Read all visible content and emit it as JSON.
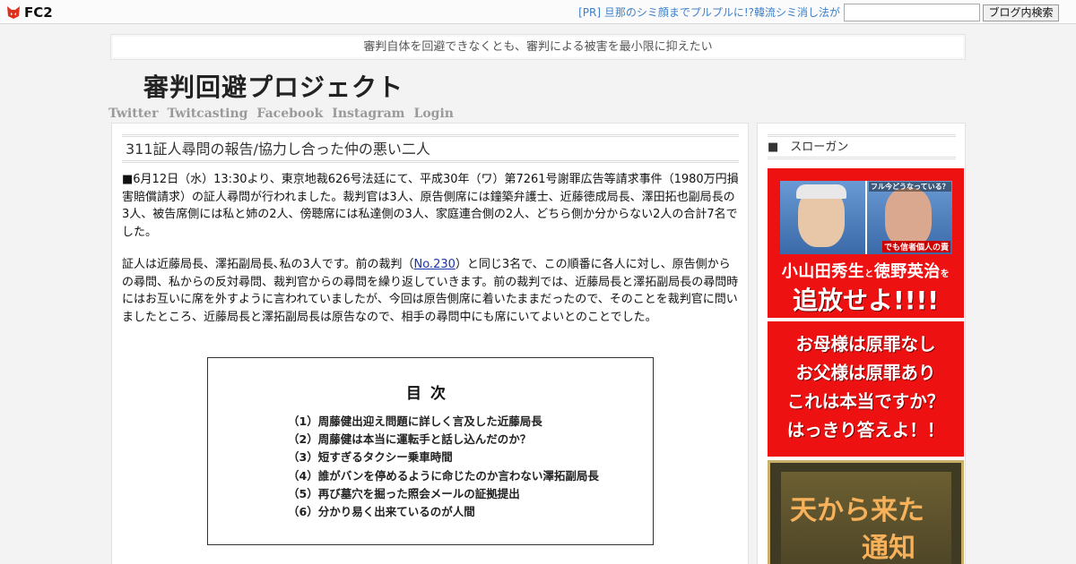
{
  "topbar": {
    "logo": "FC2",
    "pr_link": "[PR] 旦那のシミ顔までプルプルに!?韓流シミ消し法が",
    "search_placeholder": "",
    "search_button": "ブログ内検索"
  },
  "header": {
    "tagline": "審判自体を回避できなくとも、審判による被害を最小限に抑えたい",
    "site_title": "審判回避プロジェクト",
    "nav": [
      "Twitter",
      "Twitcasting",
      "Facebook",
      "Instagram",
      "Login"
    ]
  },
  "article": {
    "title": "311証人尋問の報告/協力し合った仲の悪い二人",
    "p1": "■6月12日（水）13:30より、東京地裁626号法廷にて、平成30年（ワ）第7261号謝罪広告等請求事件（1980万円損害賠償請求）の証人尋問が行われました。裁判官は3人、原告側席には鐘築弁護士、近藤徳成局長、澤田拓也副局長の3人、被告席側には私と姉の2人、傍聴席には私達側の3人、家庭連合側の2人、どちら側か分からない2人の合計7名でした。",
    "p2_before": "証人は近藤局長、澤拓副局長､私の3人です。前の裁判（",
    "p2_link": "No.230",
    "p2_after": "）と同じ3名で、この順番に各人に対し、原告側からの尋問、私からの反対尋問、裁判官からの尋問を繰り返していきます。前の裁判では、近藤局長と澤拓副局長の尋問時にはお互いに席を外すように言われていましたが、今回は原告側席に着いたままだったので、そのことを裁判官に問いましたところ、近藤局長と澤拓副局長は原告なので、相手の尋問中にも席にいてよいとのことでした。",
    "toc": {
      "title": "目次",
      "items": [
        "（1）周藤健出迎え問題に詳しく言及した近藤局長",
        "（2）周藤健は本当に運転手と話し込んだのか？",
        "（3）短すぎるタクシー乗車時間",
        "（4）誰がバンを停めるように命じたのか言わない澤拓副局長",
        "（5）再び墓穴を掘った照会メールの証拠提出",
        "（6）分かり易く出来ているのが人間"
      ]
    }
  },
  "sidebar": {
    "heading": "■　スローガン",
    "banner1": {
      "photo_top_label": "フル今どうなっている？",
      "photo_tag": "でも信者個人の責",
      "name1": "小山田秀生",
      "joiner": "と",
      "name2": "徳野英治",
      "particle": "を",
      "slogan": "追放せよ!!!!"
    },
    "banner2": {
      "line1": "お母様は原罪なし",
      "line2": "お父様は原罪あり",
      "line3": "これは本当ですか？",
      "line4": "はっきり答えよ！！"
    },
    "banner3": {
      "line1": "天から来た",
      "line2": "通知"
    }
  }
}
